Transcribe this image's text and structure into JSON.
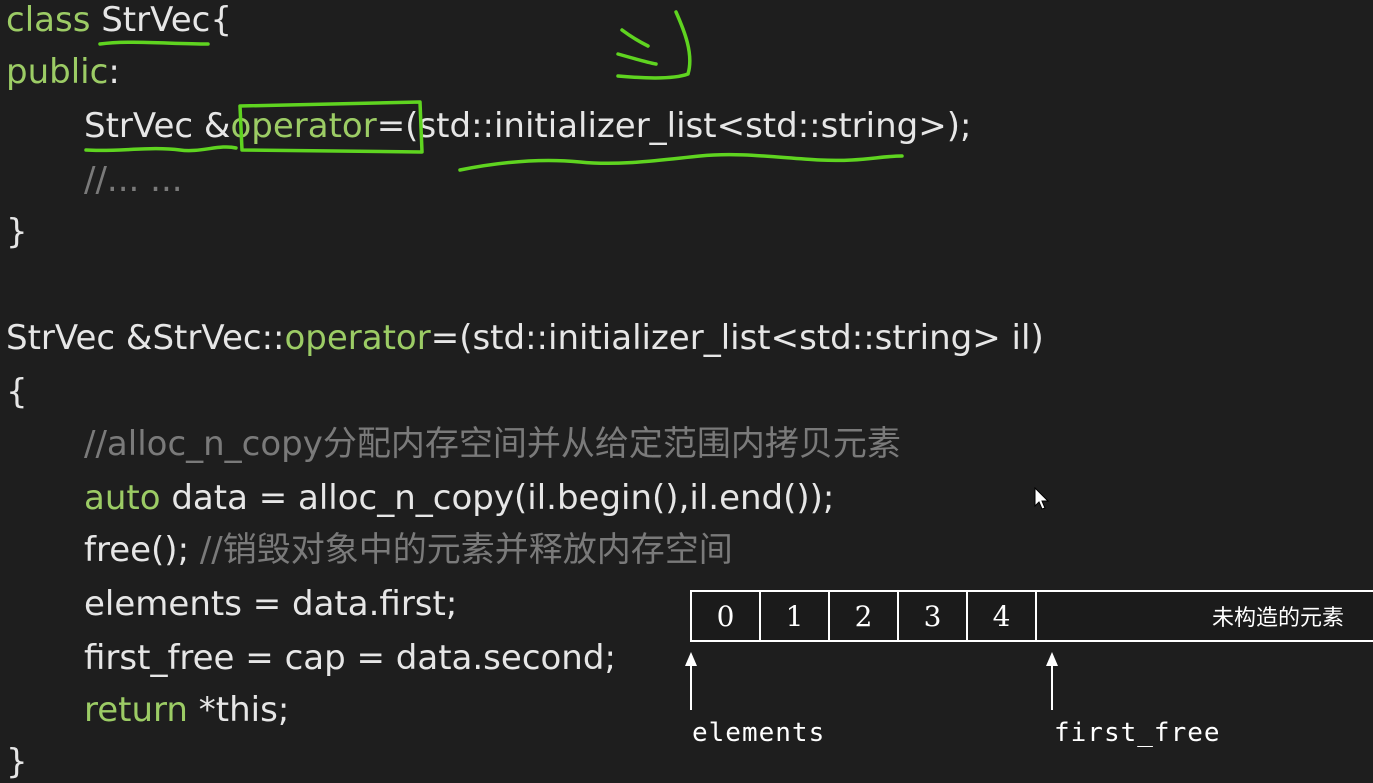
{
  "code": {
    "l1_kw": "class",
    "l1_name": "StrVec",
    "l1_brace": "{",
    "l2_kw": "public",
    "l2_colon": ":",
    "l3_type": "StrVec &",
    "l3_op": "operator",
    "l3_rest": "=(std::initializer_list<std::string>);",
    "l4_comment": "//... ...",
    "l5_brace": "}",
    "l6_pre": "StrVec &StrVec::",
    "l6_op": "operator",
    "l6_rest": "=(std::initializer_list<std::string> il)",
    "l7_brace": "{",
    "l8_comment": "//alloc_n_copy分配内存空间并从给定范围内拷贝元素",
    "l9_kw": "auto",
    "l9_rest": " data = alloc_n_copy(il.begin(),il.end());",
    "l10_code": "free(); ",
    "l10_comment": "//销毁对象中的元素并释放内存空间",
    "l11_code": "elements = data.first;",
    "l12_code": "first_free = cap = data.second;",
    "l13_kw": "return",
    "l13_rest": " *this;",
    "l14_brace": "}"
  },
  "diagram": {
    "cells": [
      "0",
      "1",
      "2",
      "3",
      "4"
    ],
    "unconstructed": "未构造的元素",
    "ptr_elements": "elements",
    "ptr_first_free": "first_free"
  },
  "colors": {
    "keyword": "#9ccc65",
    "comment": "#7a7a7a",
    "text": "#e6e6e6",
    "annotation": "#5fd420",
    "background": "#1e1e1e"
  }
}
